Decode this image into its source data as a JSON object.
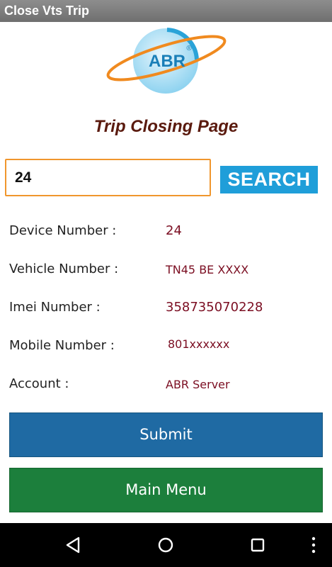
{
  "app": {
    "title": "Close Vts Trip"
  },
  "logo": {
    "text": "ABR",
    "mark": "®"
  },
  "page": {
    "title": "Trip Closing Page"
  },
  "search": {
    "value": "24",
    "button_label": "SEARCH"
  },
  "details": [
    {
      "label": "Device Number :",
      "value": "24"
    },
    {
      "label": "Vehicle Number :",
      "value": "TN45 BE XXXX"
    },
    {
      "label": "Imei Number :",
      "value": "358735070228"
    },
    {
      "label": "Mobile Number :",
      "value": "801xxxxxx"
    },
    {
      "label": "Account :",
      "value": "ABR Server"
    }
  ],
  "actions": {
    "submit_label": "Submit",
    "main_menu_label": "Main Menu"
  },
  "navigation": {
    "back_icon": "back-icon",
    "home_icon": "home-icon",
    "recents_icon": "recents-icon",
    "menu_icon": "overflow-menu-icon"
  },
  "colors": {
    "title_bar": "#7d7d7d",
    "search_border": "#f0962d",
    "search_button": "#1f9ed9",
    "value_text": "#7b0e22",
    "submit_button": "#1f6aa3",
    "main_menu_button": "#1c7f3c",
    "page_title": "#5a1a0e"
  }
}
